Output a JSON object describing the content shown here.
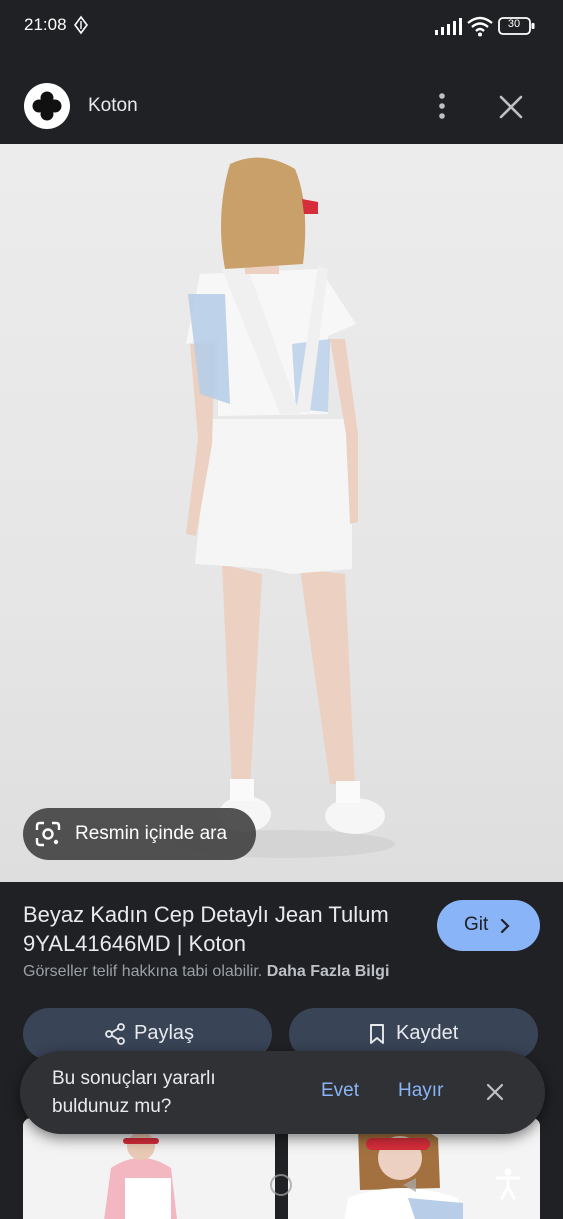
{
  "status_bar": {
    "time": "21:08",
    "battery": "30"
  },
  "app_bar": {
    "title": "Koton"
  },
  "image_overlay": {
    "lens_label": "Resmin içinde ara"
  },
  "result": {
    "title": "Beyaz Kadın Cep Detaylı Jean Tulum 9YAL41646MD | Koton",
    "go_label": "Git",
    "copyright_notice": "Görseller telif hakkına tabi olabilir.",
    "more_info_link": "Daha Fazla Bilgi"
  },
  "actions": {
    "share_label": "Paylaş",
    "save_label": "Kaydet"
  },
  "feedback": {
    "question": "Bu sonuçları yararlı buldunuz mu?",
    "yes_label": "Evet",
    "no_label": "Hayır"
  },
  "icons": {
    "sync": "sync-icon",
    "signal": "signal-icon",
    "wifi": "wifi-icon",
    "battery": "battery-icon",
    "logo": "koton-logo-icon",
    "more": "more-vert-icon",
    "close": "close-icon",
    "lens": "google-lens-icon",
    "go": "chevron-right-icon",
    "share": "share-icon",
    "save": "bookmark-icon",
    "accessibility": "accessibility-icon"
  },
  "colors": {
    "background": "#202124",
    "accent": "#8ab4f8",
    "button_bg": "#394457",
    "feedback_bg": "#303134"
  }
}
